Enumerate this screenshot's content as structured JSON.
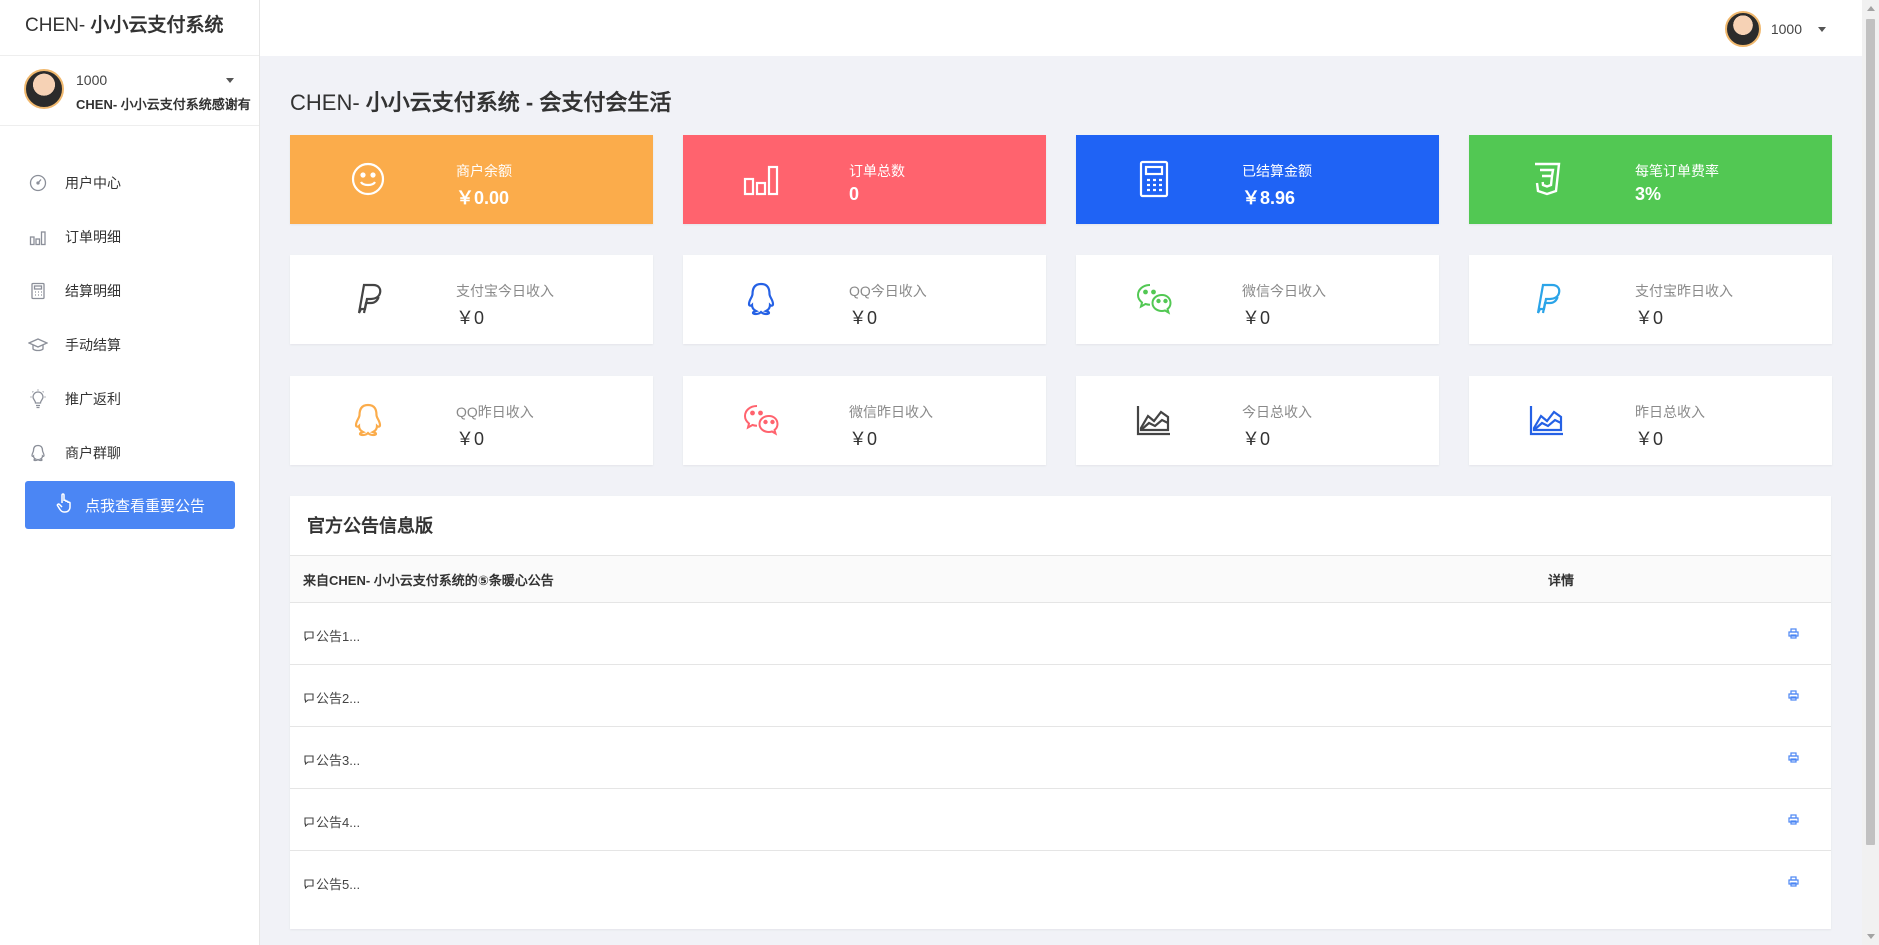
{
  "brand": {
    "prefix": "CHEN- ",
    "name": "小小云支付系统"
  },
  "user": {
    "name": "1000",
    "subtitle": "CHEN- 小小云支付系统感谢有"
  },
  "nav": [
    {
      "label": "用户中心",
      "icon": "dashboard-icon"
    },
    {
      "label": "订单明细",
      "icon": "bar-chart-icon"
    },
    {
      "label": "结算明细",
      "icon": "calculator-icon"
    },
    {
      "label": "手动结算",
      "icon": "graduation-cap-icon"
    },
    {
      "label": "推广返利",
      "icon": "lightbulb-icon"
    },
    {
      "label": "商户群聊",
      "icon": "qq-icon"
    }
  ],
  "notice_button": "点我查看重要公告",
  "topbar": {
    "username": "1000"
  },
  "page_title": {
    "prefix": "CHEN- ",
    "name": "小小云支付系统",
    "suffix": " - 会支付会生活"
  },
  "stats_row1": [
    {
      "label": "商户余额",
      "value": "￥0.00",
      "color": "#fbac4b",
      "icon": "smile-icon"
    },
    {
      "label": "订单总数",
      "value": "0",
      "color": "#ff636e",
      "icon": "bar-chart-icon"
    },
    {
      "label": "已结算金额",
      "value": "￥8.96",
      "color": "#1f63f5",
      "icon": "calculator-icon"
    },
    {
      "label": "每笔订单费率",
      "value": "3%",
      "color": "#52c853",
      "icon": "css3-icon"
    }
  ],
  "stats_row2": [
    {
      "label": "支付宝今日收入",
      "value": "￥0",
      "icon": "paypal-icon",
      "icon_color": "#444444"
    },
    {
      "label": "QQ今日收入",
      "value": "￥0",
      "icon": "qq-icon",
      "icon_color": "#2561e5"
    },
    {
      "label": "微信今日收入",
      "value": "￥0",
      "icon": "wechat-icon",
      "icon_color": "#52c853"
    },
    {
      "label": "支付宝昨日收入",
      "value": "￥0",
      "icon": "paypal-icon",
      "icon_color": "#2ba4e8"
    }
  ],
  "stats_row3": [
    {
      "label": "QQ昨日收入",
      "value": "￥0",
      "icon": "qq-icon",
      "icon_color": "#fbac4b"
    },
    {
      "label": "微信昨日收入",
      "value": "￥0",
      "icon": "wechat-icon",
      "icon_color": "#ff636e"
    },
    {
      "label": "今日总收入",
      "value": "￥0",
      "icon": "area-chart-icon",
      "icon_color": "#444444"
    },
    {
      "label": "昨日总收入",
      "value": "￥0",
      "icon": "area-chart-icon",
      "icon_color": "#2561e5"
    }
  ],
  "announcements": {
    "title": "官方公告信息版",
    "header_col1": "来自CHEN- 小小云支付系统的⑤条暖心公告",
    "header_col2": "详情",
    "rows": [
      "公告1...",
      "公告2...",
      "公告3...",
      "公告4...",
      "公告5..."
    ]
  }
}
